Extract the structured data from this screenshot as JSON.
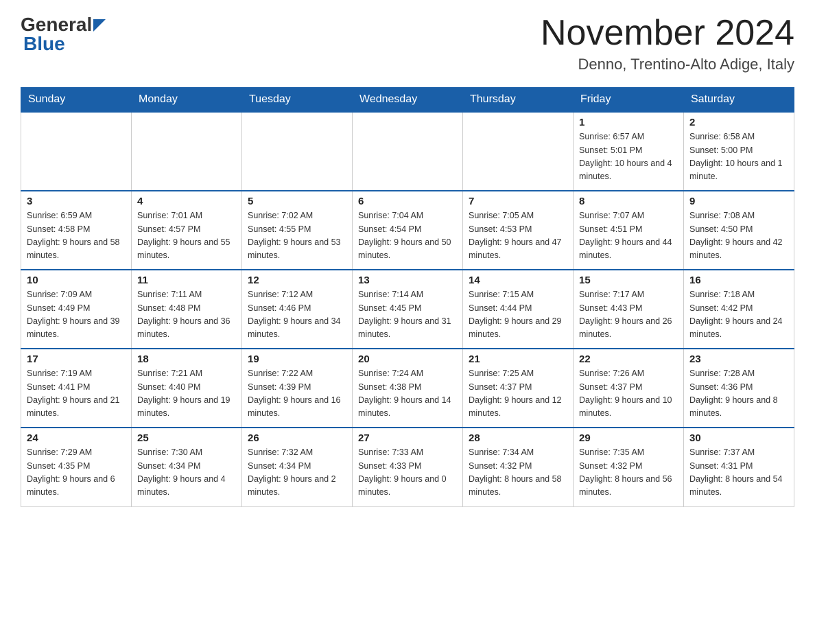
{
  "header": {
    "title": "November 2024",
    "location": "Denno, Trentino-Alto Adige, Italy",
    "logo_general": "General",
    "logo_blue": "Blue"
  },
  "days_of_week": [
    "Sunday",
    "Monday",
    "Tuesday",
    "Wednesday",
    "Thursday",
    "Friday",
    "Saturday"
  ],
  "weeks": [
    [
      {
        "day": "",
        "info": "",
        "empty": true
      },
      {
        "day": "",
        "info": "",
        "empty": true
      },
      {
        "day": "",
        "info": "",
        "empty": true
      },
      {
        "day": "",
        "info": "",
        "empty": true
      },
      {
        "day": "",
        "info": "",
        "empty": true
      },
      {
        "day": "1",
        "info": "Sunrise: 6:57 AM\nSunset: 5:01 PM\nDaylight: 10 hours and 4 minutes."
      },
      {
        "day": "2",
        "info": "Sunrise: 6:58 AM\nSunset: 5:00 PM\nDaylight: 10 hours and 1 minute."
      }
    ],
    [
      {
        "day": "3",
        "info": "Sunrise: 6:59 AM\nSunset: 4:58 PM\nDaylight: 9 hours and 58 minutes."
      },
      {
        "day": "4",
        "info": "Sunrise: 7:01 AM\nSunset: 4:57 PM\nDaylight: 9 hours and 55 minutes."
      },
      {
        "day": "5",
        "info": "Sunrise: 7:02 AM\nSunset: 4:55 PM\nDaylight: 9 hours and 53 minutes."
      },
      {
        "day": "6",
        "info": "Sunrise: 7:04 AM\nSunset: 4:54 PM\nDaylight: 9 hours and 50 minutes."
      },
      {
        "day": "7",
        "info": "Sunrise: 7:05 AM\nSunset: 4:53 PM\nDaylight: 9 hours and 47 minutes."
      },
      {
        "day": "8",
        "info": "Sunrise: 7:07 AM\nSunset: 4:51 PM\nDaylight: 9 hours and 44 minutes."
      },
      {
        "day": "9",
        "info": "Sunrise: 7:08 AM\nSunset: 4:50 PM\nDaylight: 9 hours and 42 minutes."
      }
    ],
    [
      {
        "day": "10",
        "info": "Sunrise: 7:09 AM\nSunset: 4:49 PM\nDaylight: 9 hours and 39 minutes."
      },
      {
        "day": "11",
        "info": "Sunrise: 7:11 AM\nSunset: 4:48 PM\nDaylight: 9 hours and 36 minutes."
      },
      {
        "day": "12",
        "info": "Sunrise: 7:12 AM\nSunset: 4:46 PM\nDaylight: 9 hours and 34 minutes."
      },
      {
        "day": "13",
        "info": "Sunrise: 7:14 AM\nSunset: 4:45 PM\nDaylight: 9 hours and 31 minutes."
      },
      {
        "day": "14",
        "info": "Sunrise: 7:15 AM\nSunset: 4:44 PM\nDaylight: 9 hours and 29 minutes."
      },
      {
        "day": "15",
        "info": "Sunrise: 7:17 AM\nSunset: 4:43 PM\nDaylight: 9 hours and 26 minutes."
      },
      {
        "day": "16",
        "info": "Sunrise: 7:18 AM\nSunset: 4:42 PM\nDaylight: 9 hours and 24 minutes."
      }
    ],
    [
      {
        "day": "17",
        "info": "Sunrise: 7:19 AM\nSunset: 4:41 PM\nDaylight: 9 hours and 21 minutes."
      },
      {
        "day": "18",
        "info": "Sunrise: 7:21 AM\nSunset: 4:40 PM\nDaylight: 9 hours and 19 minutes."
      },
      {
        "day": "19",
        "info": "Sunrise: 7:22 AM\nSunset: 4:39 PM\nDaylight: 9 hours and 16 minutes."
      },
      {
        "day": "20",
        "info": "Sunrise: 7:24 AM\nSunset: 4:38 PM\nDaylight: 9 hours and 14 minutes."
      },
      {
        "day": "21",
        "info": "Sunrise: 7:25 AM\nSunset: 4:37 PM\nDaylight: 9 hours and 12 minutes."
      },
      {
        "day": "22",
        "info": "Sunrise: 7:26 AM\nSunset: 4:37 PM\nDaylight: 9 hours and 10 minutes."
      },
      {
        "day": "23",
        "info": "Sunrise: 7:28 AM\nSunset: 4:36 PM\nDaylight: 9 hours and 8 minutes."
      }
    ],
    [
      {
        "day": "24",
        "info": "Sunrise: 7:29 AM\nSunset: 4:35 PM\nDaylight: 9 hours and 6 minutes."
      },
      {
        "day": "25",
        "info": "Sunrise: 7:30 AM\nSunset: 4:34 PM\nDaylight: 9 hours and 4 minutes."
      },
      {
        "day": "26",
        "info": "Sunrise: 7:32 AM\nSunset: 4:34 PM\nDaylight: 9 hours and 2 minutes."
      },
      {
        "day": "27",
        "info": "Sunrise: 7:33 AM\nSunset: 4:33 PM\nDaylight: 9 hours and 0 minutes."
      },
      {
        "day": "28",
        "info": "Sunrise: 7:34 AM\nSunset: 4:32 PM\nDaylight: 8 hours and 58 minutes."
      },
      {
        "day": "29",
        "info": "Sunrise: 7:35 AM\nSunset: 4:32 PM\nDaylight: 8 hours and 56 minutes."
      },
      {
        "day": "30",
        "info": "Sunrise: 7:37 AM\nSunset: 4:31 PM\nDaylight: 8 hours and 54 minutes."
      }
    ]
  ]
}
